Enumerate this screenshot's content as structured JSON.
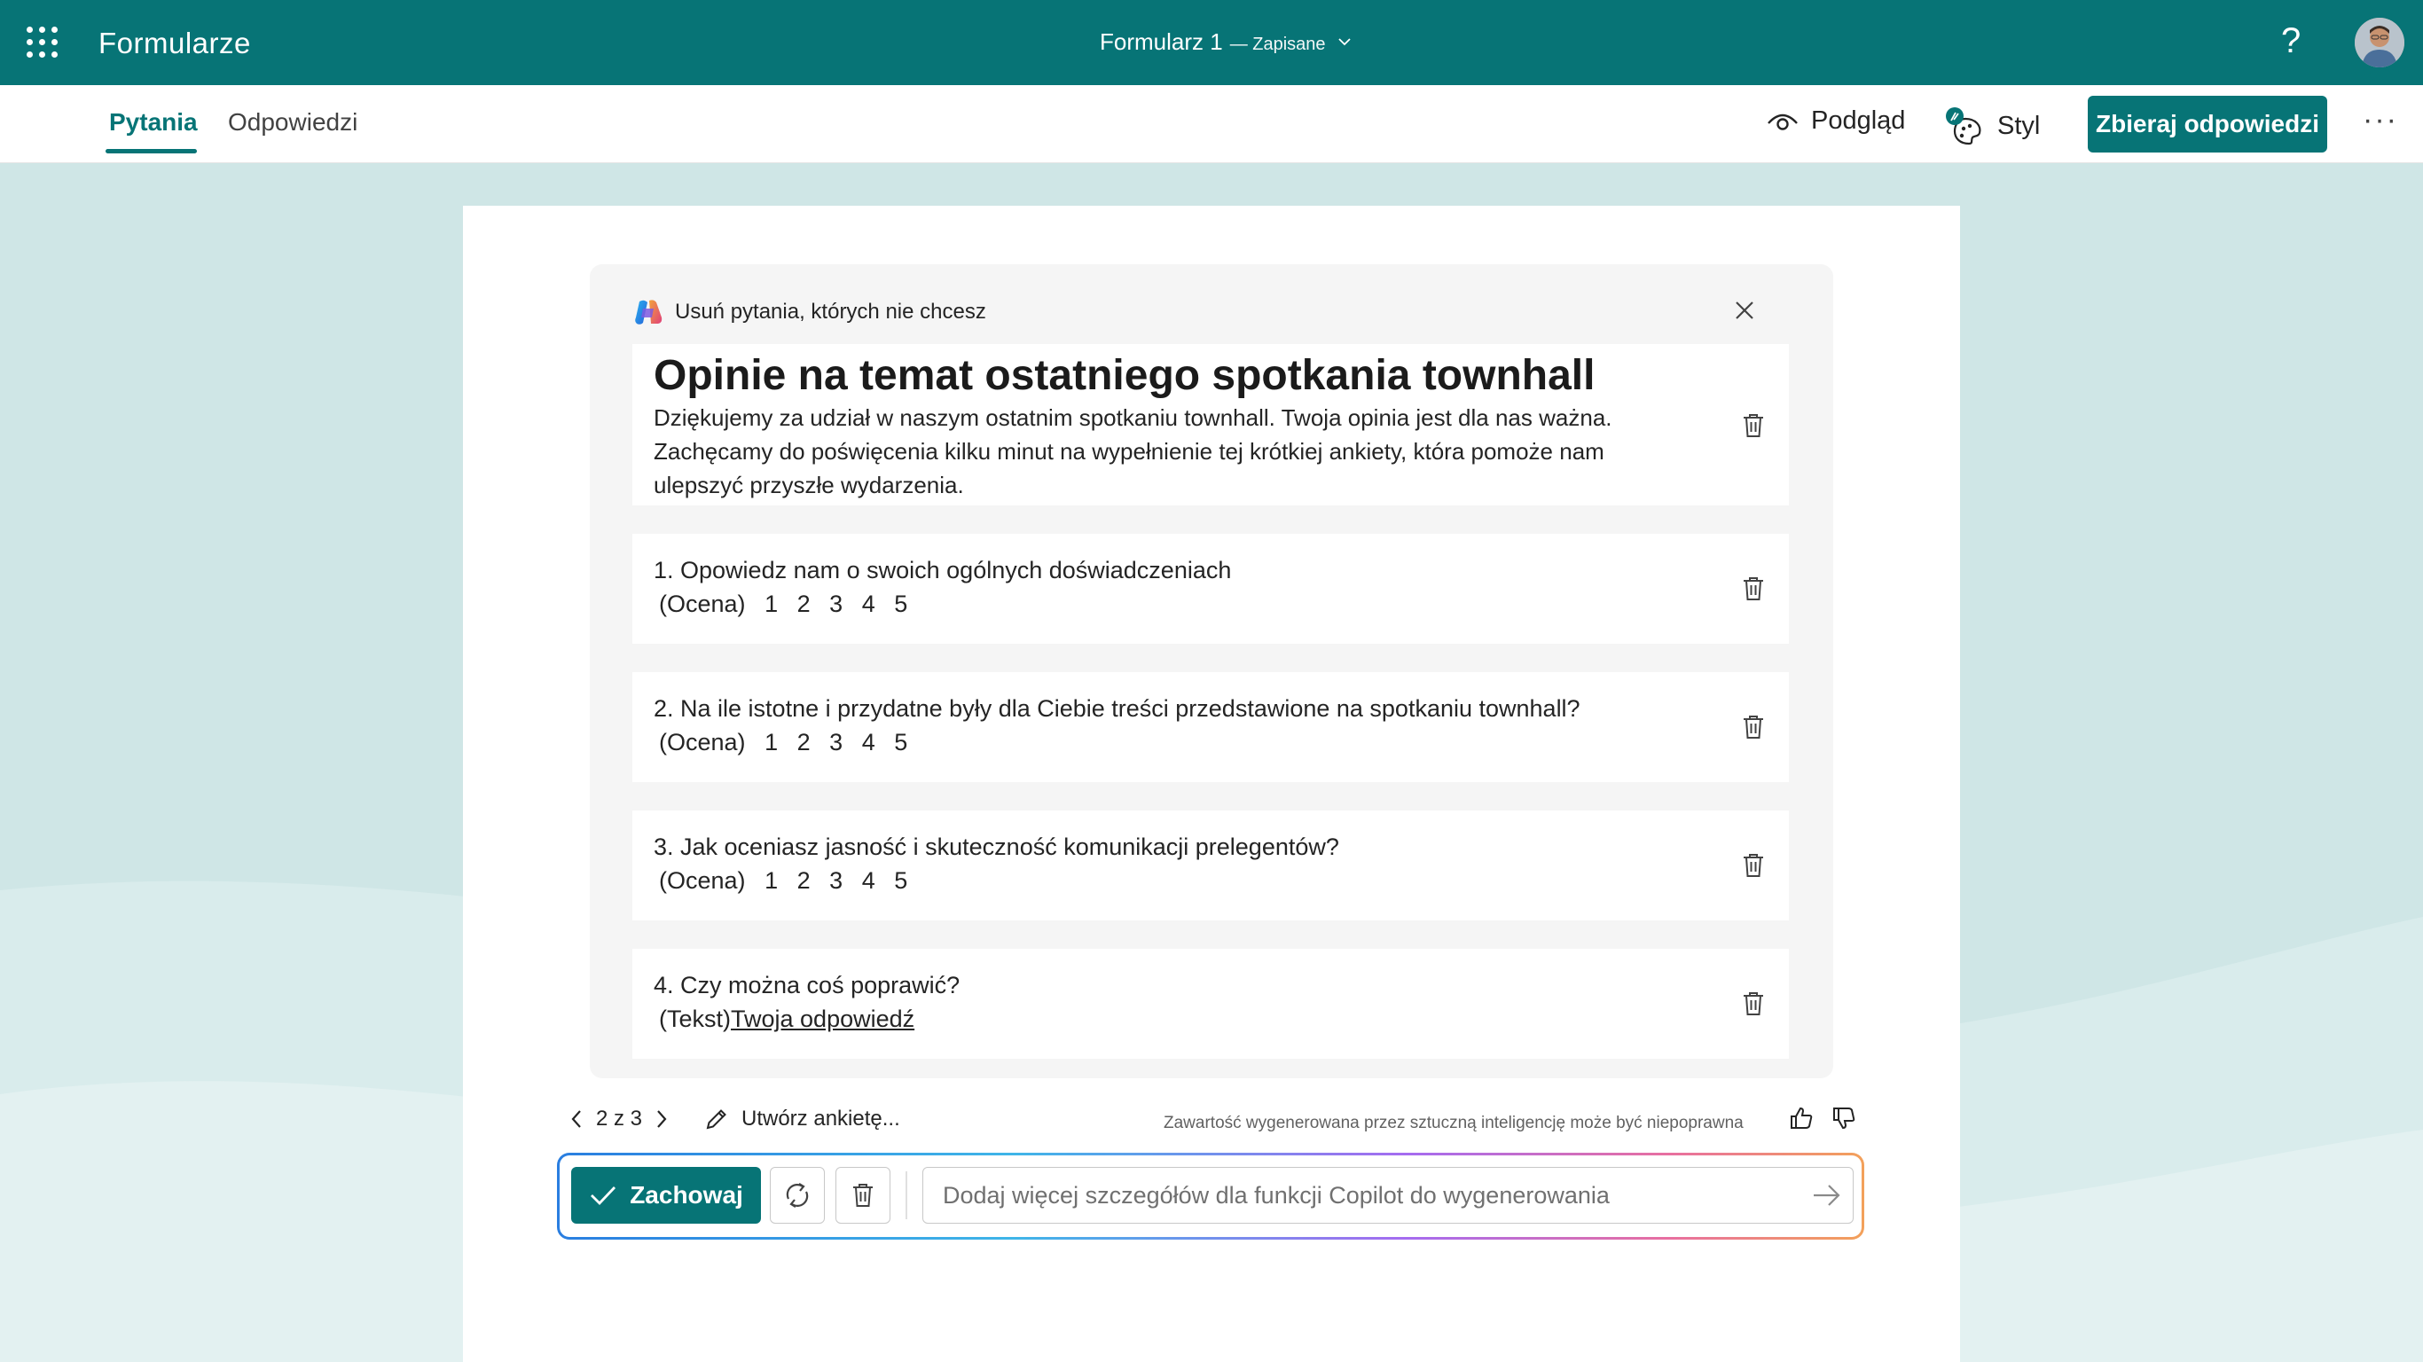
{
  "app": {
    "name": "Formularze"
  },
  "document": {
    "title": "Formularz 1",
    "status": "— Zapisane"
  },
  "header": {
    "help_symbol": "?"
  },
  "tabs": [
    {
      "label": "Pytania",
      "active": true
    },
    {
      "label": "Odpowiedzi",
      "active": false
    }
  ],
  "toolbar": {
    "preview_label": "Podgląd",
    "style_label": "Styl",
    "collect_label": "Zbieraj odpowiedzi",
    "more_label": "···"
  },
  "copilot_panel": {
    "header": "Usuń pytania, których nie chcesz",
    "form_title": "Opinie na temat ostatniego spotkania townhall",
    "form_description": "Dziękujemy za udział w naszym ostatnim spotkaniu townhall. Twoja opinia jest dla nas ważna. Zachęcamy do poświęcenia kilku minut na wypełnienie tej krótkiej ankiety, która pomoże nam ulepszyć przyszłe wydarzenia.",
    "questions": [
      {
        "text": "1. Opowiedz nam o swoich ogólnych doświadczeniach",
        "type": "(Ocena)",
        "options": [
          "1",
          "2",
          "3",
          "4",
          "5"
        ]
      },
      {
        "text": "2. Na ile istotne i przydatne były dla Ciebie treści przedstawione na spotkaniu townhall?",
        "type": "(Ocena)",
        "options": [
          "1",
          "2",
          "3",
          "4",
          "5"
        ]
      },
      {
        "text": "3. Jak oceniasz jasność i skuteczność komunikacji prelegentów?",
        "type": "(Ocena)",
        "options": [
          "1",
          "2",
          "3",
          "4",
          "5"
        ]
      },
      {
        "text": "4. Czy można coś poprawić?",
        "type": "(Tekst)",
        "answer_placeholder": "Twoja odpowiedź"
      }
    ]
  },
  "controls": {
    "pager": "2 z 3",
    "create_survey": "Utwórz ankietę...",
    "disclaimer": "Zawartość wygenerowana przez sztuczną inteligencję może być niepoprawna",
    "keep_label": "Zachowaj",
    "prompt_placeholder": "Dodaj więcej szczegółów dla funkcji Copilot do wygenerowania"
  },
  "colors": {
    "brand": "#077476",
    "canvas": "#cfe6e6",
    "panel": "#f5f5f5"
  },
  "icons": [
    "waffle-icon",
    "chevron-down-icon",
    "help-icon",
    "eye-icon",
    "palette-icon",
    "copilot-icon",
    "close-icon",
    "trash-icon",
    "chevron-left-icon",
    "chevron-right-icon",
    "pencil-icon",
    "thumbs-up-icon",
    "thumbs-down-icon",
    "checkmark-icon",
    "refresh-icon",
    "send-icon"
  ]
}
